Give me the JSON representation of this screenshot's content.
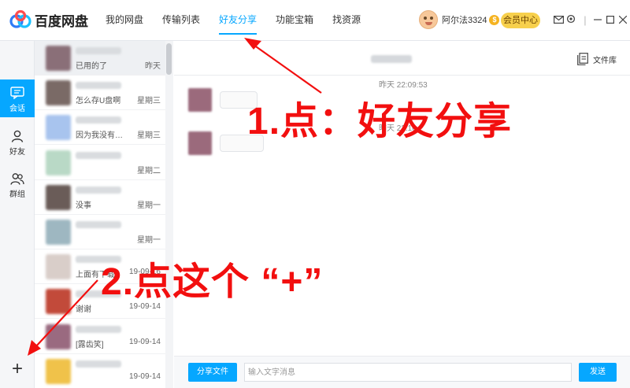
{
  "app": {
    "name": "百度网盘"
  },
  "nav": [
    "我的网盘",
    "传输列表",
    "好友分享",
    "功能宝箱",
    "找资源"
  ],
  "nav_active_index": 2,
  "user": {
    "name": "阿尔法3324",
    "vip_mark": "$",
    "member_center": "会员中心"
  },
  "header_icons": [
    "mail-icon",
    "settings-icon",
    "minimize-icon",
    "maximize-icon",
    "close-icon"
  ],
  "rail": {
    "items": [
      "会话",
      "好友",
      "群组"
    ],
    "active_index": 0,
    "add_glyph": "+"
  },
  "conversations": [
    {
      "preview": "已用的了",
      "date": "昨天",
      "avatar_color": "#8a6f78"
    },
    {
      "preview": "怎么存U盘啊",
      "date": "星期三",
      "avatar_color": "#7a6a66"
    },
    {
      "preview": "因为我没有…",
      "date": "星期三",
      "avatar_color": "#a8c4ee"
    },
    {
      "preview": "",
      "date": "星期二",
      "avatar_color": "#b9d9c6"
    },
    {
      "preview": "没事",
      "date": "星期一",
      "avatar_color": "#6a5c58"
    },
    {
      "preview": "",
      "date": "星期一",
      "avatar_color": "#9eb7c1"
    },
    {
      "preview": "上面有下载",
      "date": "19-09-16",
      "avatar_color": "#d9cec9"
    },
    {
      "preview": "谢谢",
      "date": "19-09-14",
      "avatar_color": "#c24a3a"
    },
    {
      "preview": "[露齿笑]",
      "date": "19-09-14",
      "avatar_color": "#9a6a80"
    },
    {
      "preview": "",
      "date": "19-09-14",
      "avatar_color": "#f0c24a"
    }
  ],
  "chat": {
    "library_label": "文件库",
    "timestamp1": "昨天  22:09:53",
    "timestamp2": "昨天 22:10"
  },
  "input": {
    "share_file": "分享文件",
    "placeholder": "输入文字消息",
    "send": "发送"
  },
  "annotations": {
    "step1": "1.点：好友分享",
    "step2": "2.点这个 “+”",
    "color": "#f20f0f"
  },
  "colors": {
    "accent": "#06a7ff",
    "vip": "#f7d04c"
  }
}
